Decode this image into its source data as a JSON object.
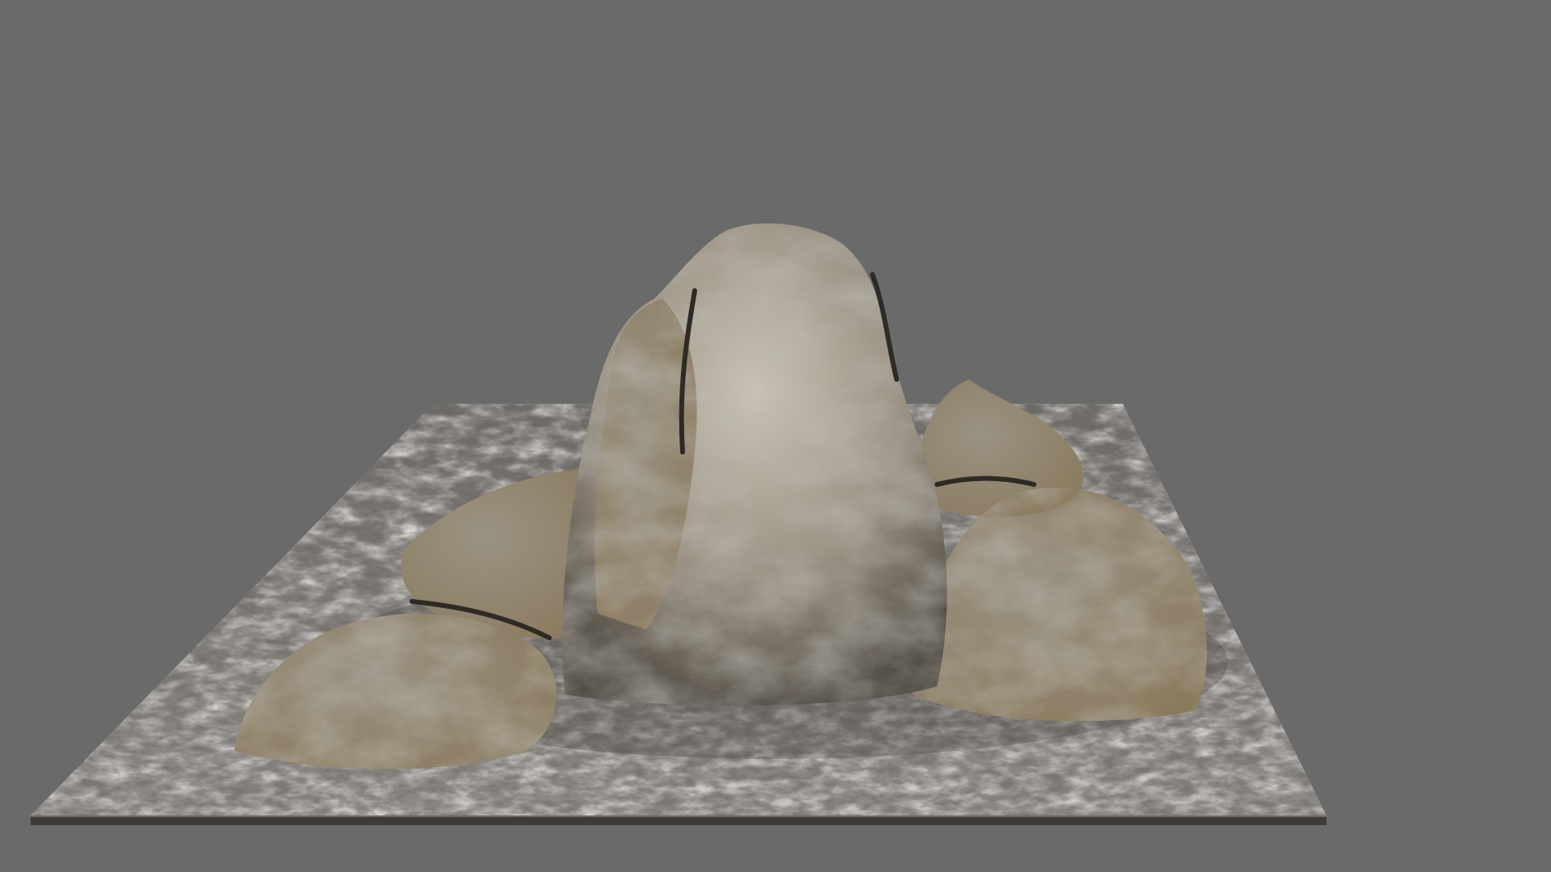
{
  "scene": {
    "subject": "rock-formation-on-terrain-slab",
    "colors": {
      "background": "#6a6a6a",
      "slab_light": "#8e8a86",
      "slab_mid": "#6f6b68",
      "slab_dark": "#4a4744",
      "slab_edge": "#3e3b38",
      "rock_light": "#c9c2b4",
      "rock_mid": "#9a9283",
      "rock_warm": "#8a7a5c",
      "rock_dark": "#4f4a42",
      "crevice": "#2e2a25"
    }
  }
}
